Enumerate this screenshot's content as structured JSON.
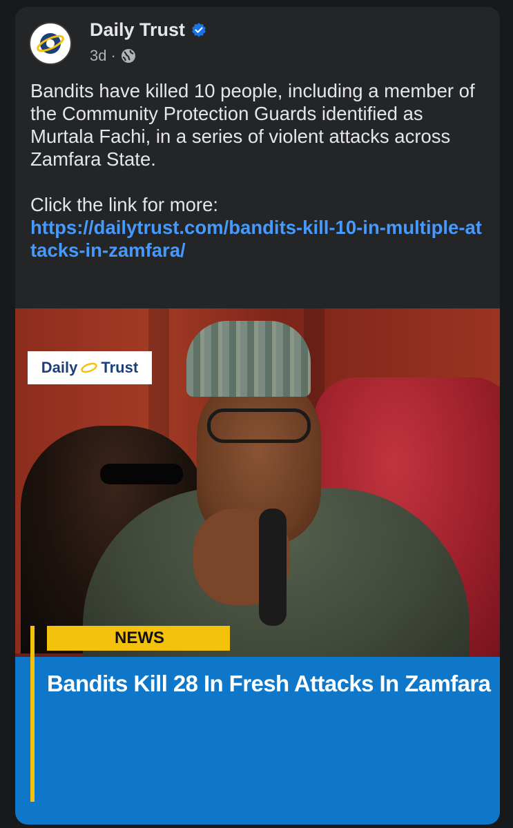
{
  "post": {
    "page_name": "Daily Trust",
    "verified": true,
    "timestamp": "3d",
    "separator": "·",
    "privacy_icon": "globe-icon",
    "body_paragraph": "Bandits have killed 10 people, including a member of the Community Protection Guards identified as Murtala Fachi, in a series of violent attacks across Zamfara State.",
    "cta_text": "Click the link for more:",
    "link": "https://dailytrust.com/bandits-kill-10-in-multiple-attacks-in-zamfara/"
  },
  "image": {
    "logo_left": "Daily",
    "logo_right": "Trust",
    "news_tag": "NEWS",
    "headline": "Bandits Kill 28 In Fresh Attacks In Zamfara"
  },
  "colors": {
    "background": "#18191a",
    "card": "#242526",
    "link": "#4599ff",
    "verified_badge": "#1b74e4",
    "news_yellow": "#f4c20d",
    "band_blue": "#0e77c9"
  }
}
